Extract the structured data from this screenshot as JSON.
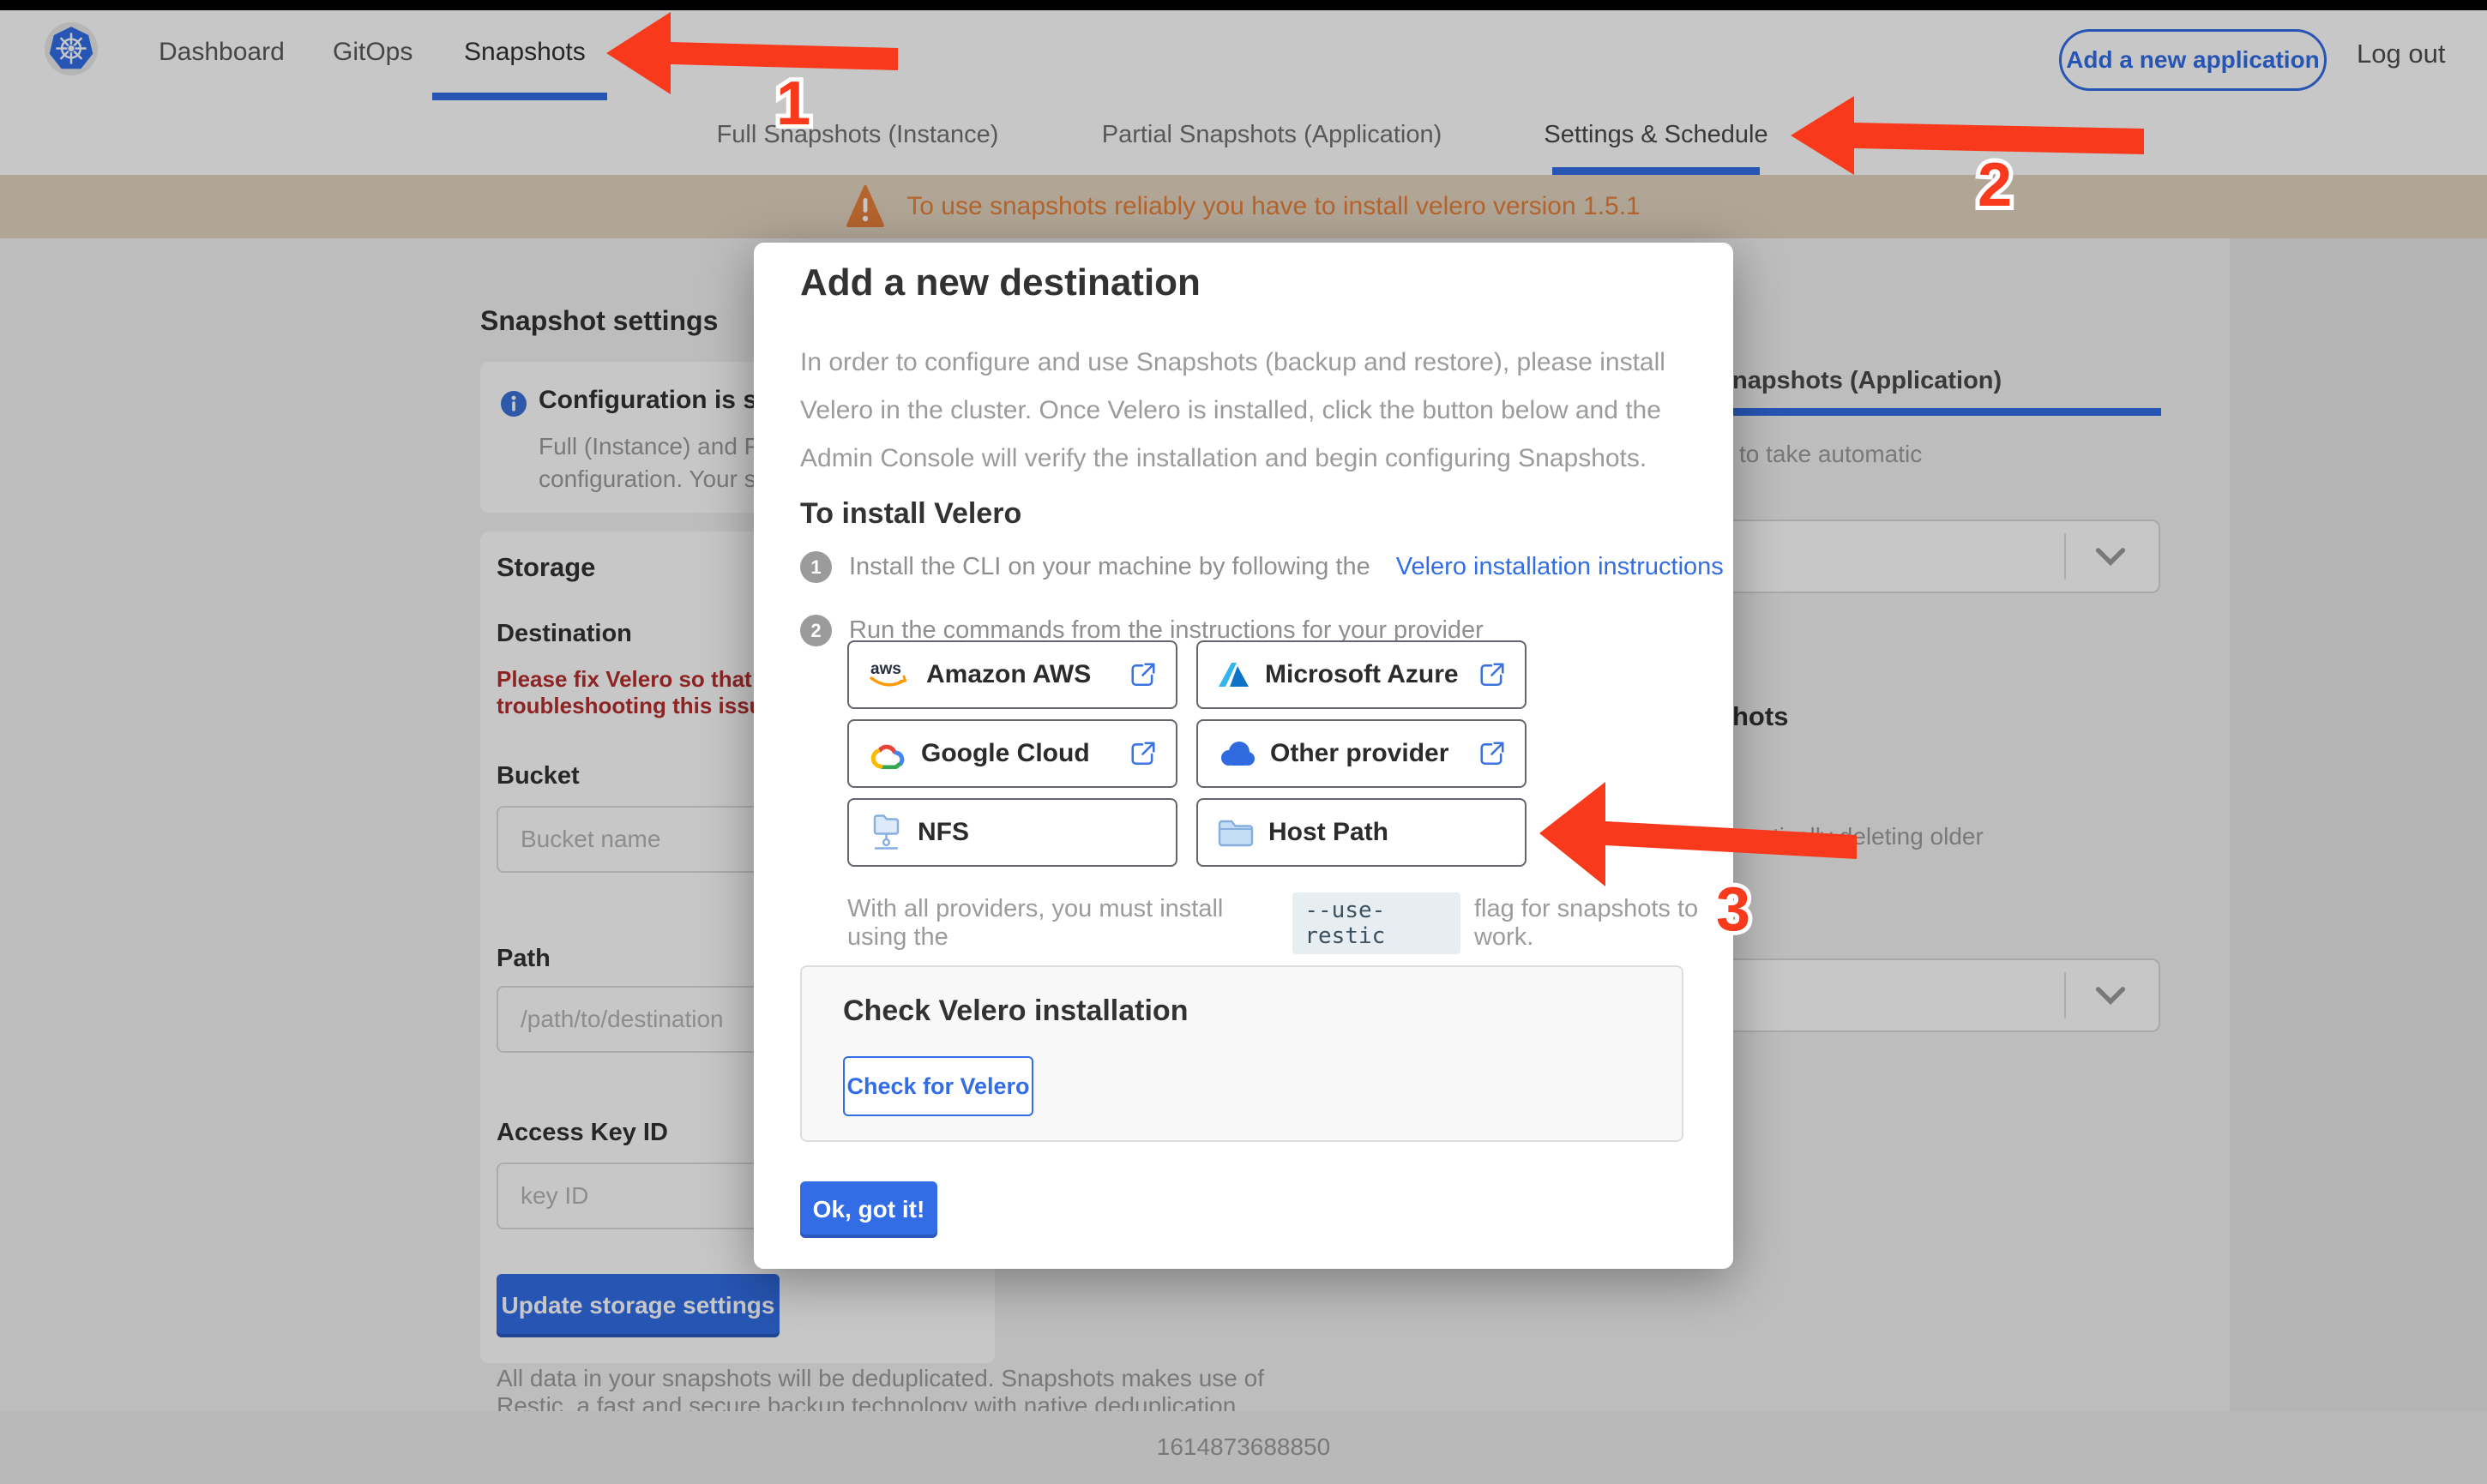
{
  "topnav": {
    "items": [
      {
        "label": "Dashboard"
      },
      {
        "label": "GitOps"
      },
      {
        "label": "Snapshots"
      }
    ],
    "add_app": "Add a new application",
    "logout": "Log out"
  },
  "subnav": {
    "tabs": [
      {
        "label": "Full Snapshots (Instance)"
      },
      {
        "label": "Partial Snapshots (Application)"
      },
      {
        "label": "Settings & Schedule"
      }
    ]
  },
  "banner": {
    "text": "To use snapshots reliably you have to install velero version 1.5.1"
  },
  "modal": {
    "title": "Add a new destination",
    "body_lines": [
      "In order to configure and use Snapshots (backup and restore), please install",
      "Velero in the cluster. Once Velero is installed, click the button below and the",
      "Admin Console will verify the installation and begin configuring Snapshots."
    ],
    "install_heading": "To install Velero",
    "steps": [
      {
        "num": "1",
        "text": "Install the CLI on your machine by following the",
        "link": "Velero installation instructions"
      },
      {
        "num": "2",
        "text": "Run the commands from the instructions for your provider"
      }
    ],
    "providers": [
      {
        "label": "Amazon AWS",
        "icon": "aws-icon",
        "external": true
      },
      {
        "label": "Microsoft Azure",
        "icon": "azure-icon",
        "external": true
      },
      {
        "label": "Google Cloud",
        "icon": "google-cloud-icon",
        "external": true
      },
      {
        "label": "Other provider",
        "icon": "cloud-icon",
        "external": true
      },
      {
        "label": "NFS",
        "icon": "nfs-folder-icon",
        "external": false
      },
      {
        "label": "Host Path",
        "icon": "folder-icon",
        "external": false
      }
    ],
    "restic": {
      "before": "With all providers, you must install using the",
      "code": "--use-restic",
      "after": "flag for snapshots to work."
    },
    "check": {
      "title": "Check Velero installation",
      "button": "Check for Velero"
    },
    "ok_label": "Ok, got it!"
  },
  "left": {
    "heading": "Snapshot settings",
    "info": {
      "title": "Configuration is sh",
      "line1": "Full (Instance) and Parti",
      "line2": "configuration. Your stor"
    },
    "storage": {
      "heading": "Storage",
      "destination": "Destination",
      "error1": "Please fix Velero so that th",
      "error2": "troubleshooting this issue",
      "bucket_label": "Bucket",
      "bucket_placeholder": "Bucket name",
      "path_label": "Path",
      "path_placeholder": "/path/to/destination",
      "key_label": "Access Key ID",
      "key_placeholder": "key ID",
      "update_label": "Update storage settings"
    },
    "dedup": {
      "line1": "All data in your snapshots will be deduplicated. Snapshots makes use of",
      "line2": "Restic, a fast and secure backup technology with native deduplication."
    }
  },
  "right": {
    "tab_fragment": "napshots (Application)",
    "auto_fragment": "to take automatic",
    "snap_fragment": "hots",
    "older_fragment": "matically deleting older"
  },
  "footer": {
    "timestamp": "1614873688850"
  },
  "annotations": [
    "1",
    "2",
    "3"
  ],
  "colors": {
    "accent": "#326de6",
    "arrow_red": "#f8391b",
    "banner_bg": "#e3d5c0",
    "banner_text": "#e8803a",
    "error_red": "#b62e2e"
  }
}
